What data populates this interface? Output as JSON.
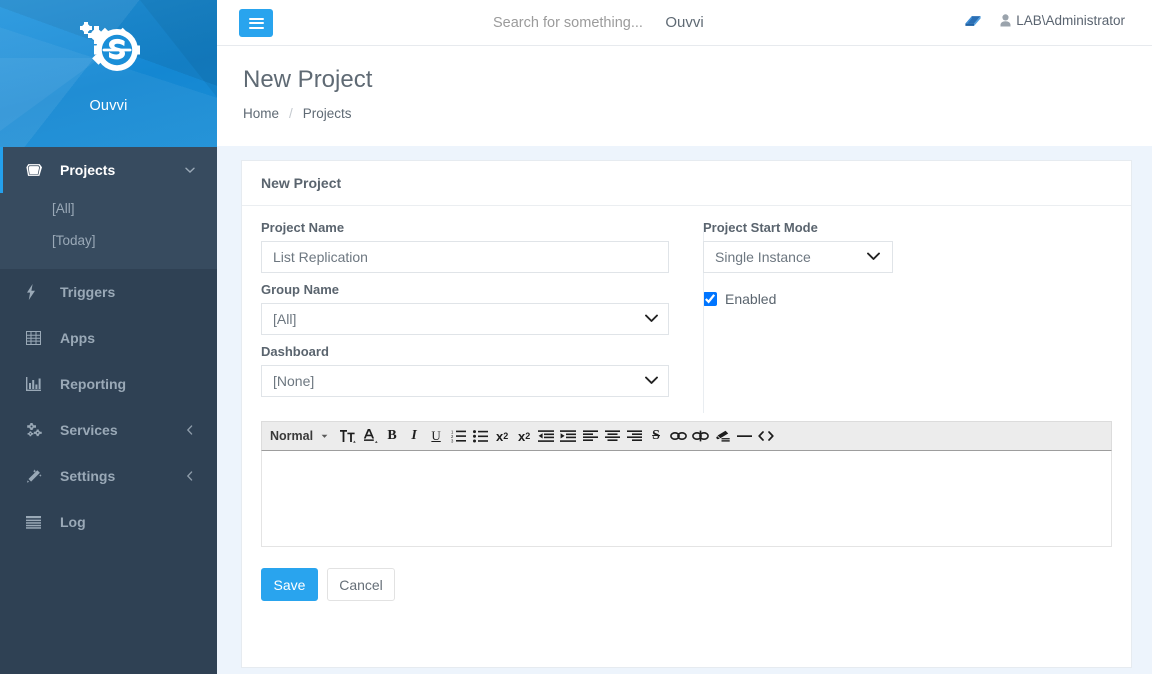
{
  "brand": {
    "name": "Ouvvi",
    "logo_icon": "gear-s-logo-icon",
    "bg_color": "#1b8fd8"
  },
  "topbar": {
    "toggle_icon": "hamburger-icon",
    "search": {
      "value": "",
      "placeholder": "Search for something..."
    },
    "app_title": "Ouvvi",
    "book_icon": "book-icon",
    "user_icon": "user-icon",
    "user_name": "LAB\\Administrator"
  },
  "page": {
    "title": "New Project",
    "breadcrumb": [
      "Home",
      "Projects"
    ],
    "breadcrumb_separator": "/"
  },
  "sidebar": {
    "items": [
      {
        "label": "Projects",
        "icon": "book-icon",
        "active": true,
        "caret": "chevron-down-icon",
        "children": [
          {
            "label": "[All]"
          },
          {
            "label": "[Today]"
          }
        ]
      },
      {
        "label": "Triggers",
        "icon": "bolt-icon",
        "active": false,
        "caret": ""
      },
      {
        "label": "Apps",
        "icon": "table-grid-icon",
        "active": false,
        "caret": ""
      },
      {
        "label": "Reporting",
        "icon": "bar-chart-icon",
        "active": false,
        "caret": ""
      },
      {
        "label": "Services",
        "icon": "cogs-icon",
        "active": false,
        "caret": "chevron-left-icon"
      },
      {
        "label": "Settings",
        "icon": "magic-wand-icon",
        "active": false,
        "caret": "chevron-left-icon"
      },
      {
        "label": "Log",
        "icon": "list-icon",
        "active": false,
        "caret": ""
      }
    ]
  },
  "panel": {
    "header": "New Project",
    "fields": {
      "project_name": {
        "label": "Project Name",
        "value": "List Replication",
        "placeholder": ""
      },
      "group_name": {
        "label": "Group Name",
        "value": "[All]",
        "options": [
          "[All]"
        ]
      },
      "dashboard": {
        "label": "Dashboard",
        "value": "[None]",
        "options": [
          "[None]"
        ]
      },
      "start_mode": {
        "label": "Project Start Mode",
        "value": "Single Instance",
        "options": [
          "Single Instance"
        ]
      },
      "enabled": {
        "label": "Enabled",
        "checked": true
      }
    },
    "editor": {
      "block_format": "Normal",
      "content": "",
      "tools": [
        {
          "name": "font-size-icon",
          "glyph": "tT"
        },
        {
          "name": "font-color-icon",
          "glyph": "A"
        },
        {
          "name": "bold-icon",
          "glyph": "B"
        },
        {
          "name": "italic-icon",
          "glyph": "I"
        },
        {
          "name": "underline-icon",
          "glyph": "U"
        },
        {
          "name": "ordered-list-icon",
          "glyph": ""
        },
        {
          "name": "unordered-list-icon",
          "glyph": ""
        },
        {
          "name": "subscript-icon",
          "glyph": "x2"
        },
        {
          "name": "superscript-icon",
          "glyph": "x2"
        },
        {
          "name": "outdent-icon",
          "glyph": ""
        },
        {
          "name": "indent-icon",
          "glyph": ""
        },
        {
          "name": "align-left-icon",
          "glyph": ""
        },
        {
          "name": "align-center-icon",
          "glyph": ""
        },
        {
          "name": "align-right-icon",
          "glyph": ""
        },
        {
          "name": "strikethrough-icon",
          "glyph": "S"
        },
        {
          "name": "link-icon",
          "glyph": ""
        },
        {
          "name": "unlink-icon",
          "glyph": ""
        },
        {
          "name": "clear-format-icon",
          "glyph": ""
        },
        {
          "name": "horizontal-rule-icon",
          "glyph": ""
        },
        {
          "name": "code-icon",
          "glyph": "<>"
        }
      ]
    },
    "actions": {
      "save": "Save",
      "cancel": "Cancel"
    }
  },
  "colors": {
    "accent": "#29a4ee",
    "sidebar": "#2f4154",
    "sidebar_active": "#374b5f",
    "page_bg": "#edf4fc"
  }
}
